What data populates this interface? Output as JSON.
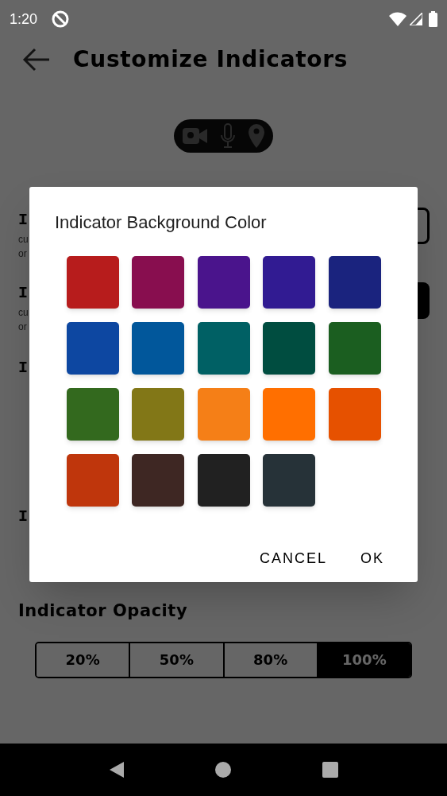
{
  "status_bar": {
    "time": "1:20"
  },
  "header": {
    "title": "Customize Indicators"
  },
  "background_sections": [
    {
      "heading": "I",
      "lines": [
        "cu",
        "or"
      ],
      "kind": "outlined"
    },
    {
      "heading": "I",
      "lines": [
        "cu",
        "or"
      ],
      "kind": "filled"
    },
    {
      "heading": "I",
      "kind": "plain"
    },
    {
      "heading": "I",
      "kind": "plain"
    }
  ],
  "opacity": {
    "title": "Indicator Opacity",
    "options": [
      {
        "label": "20%",
        "selected": false
      },
      {
        "label": "50%",
        "selected": false
      },
      {
        "label": "80%",
        "selected": false
      },
      {
        "label": "100%",
        "selected": true
      }
    ]
  },
  "dialog": {
    "title": "Indicator Background Color",
    "swatches": [
      {
        "color": "#b71c1c"
      },
      {
        "color": "#880e4f"
      },
      {
        "color": "#4a148c"
      },
      {
        "color": "#311b92"
      },
      {
        "color": "#1a237e"
      },
      {
        "color": "#0d47a1"
      },
      {
        "color": "#01579b"
      },
      {
        "color": "#006064"
      },
      {
        "color": "#004d40"
      },
      {
        "color": "#1b5e20"
      },
      {
        "color": "#33691e"
      },
      {
        "color": "#827717"
      },
      {
        "color": "#f57f17"
      },
      {
        "color": "#ff6f00"
      },
      {
        "color": "#e65100"
      },
      {
        "color": "#bf360c"
      },
      {
        "color": "#3e2723"
      },
      {
        "color": "#212121"
      },
      {
        "color": "#263238"
      }
    ],
    "buttons": [
      "CANCEL",
      "OK"
    ]
  }
}
